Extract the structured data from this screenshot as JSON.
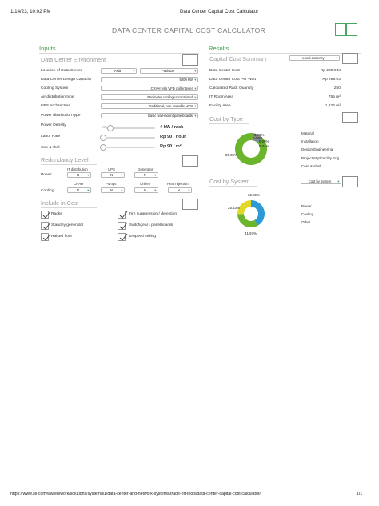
{
  "header": {
    "timestamp": "1/14/23, 10:02 PM",
    "page_title": "Data Center Capital Cost Calculator"
  },
  "footer": {
    "url": "https://www.se.com/ww/en/work/solutions/system/s1/data-center-and-network-systems/trade-off-tools/data-center-capital-cost-calculator/",
    "page_number": "1/1"
  },
  "app": {
    "title": "DATA CENTER CAPITAL COST CALCULATOR"
  },
  "inputs": {
    "heading": "Inputs",
    "environment": {
      "heading": "Data Center Environment",
      "rows": [
        {
          "label": "Location of Data Center",
          "region": "Asia",
          "country": "Pakistan"
        },
        {
          "label": "Data Center Design Capacity",
          "value": "5000 kW"
        },
        {
          "label": "Cooling System",
          "value": "CRAH with VFD chillertower"
        },
        {
          "label": "Air distribution type",
          "value": "Perimeter cooling uncontained"
        },
        {
          "label": "UPS Architecture",
          "value": "Traditional, non-scalable UPS"
        },
        {
          "label": "Power distribution type",
          "value": "Basic wall-mount panelboards"
        }
      ],
      "sliders": [
        {
          "label": "Power Density",
          "min_label": "kW",
          "value": "4 kW / rack",
          "level": 0.05
        },
        {
          "label": "Labor Rate",
          "value": "Rp 90 / hour",
          "level": 0.0
        },
        {
          "label": "Core & shell",
          "value": "Rp 90 / m²",
          "level": 0.0
        }
      ]
    },
    "redundancy": {
      "heading": "Redundancy Level",
      "power": {
        "label": "Power",
        "columns": [
          "IT distribution",
          "UPS",
          "Generator"
        ],
        "values": [
          "N",
          "N",
          "N"
        ]
      },
      "cooling": {
        "label": "Cooling",
        "columns": [
          "CRAH",
          "Pumps",
          "Chiller",
          "Heat rejection"
        ],
        "values": [
          "N",
          "N",
          "N",
          "N"
        ]
      }
    },
    "include": {
      "heading": "Include in Cost",
      "items": [
        {
          "label": "Racks",
          "checked": true
        },
        {
          "label": "Fire suppression / detection",
          "checked": true
        },
        {
          "label": "Standby generator",
          "checked": true
        },
        {
          "label": "Switchgear / panelboards",
          "checked": true
        },
        {
          "label": "Raised floor",
          "checked": true
        },
        {
          "label": "Dropped ceiling",
          "checked": true
        }
      ]
    }
  },
  "results": {
    "heading": "Results",
    "summary": {
      "heading": "Capital Cost Summary",
      "currency": "Local currency",
      "rows": [
        {
          "label": "Data Center Cost",
          "value": "Rp 289.0 M"
        },
        {
          "label": "Data Center Cost Per Watt",
          "value": "Rp 289.03"
        },
        {
          "label": "Calculated Rack Quantity",
          "value": "250"
        },
        {
          "label": "IT Room Area",
          "value": "755 m²"
        },
        {
          "label": "Facility Area",
          "value": "1,226 m²"
        }
      ]
    },
    "cost_by_type": {
      "heading": "Cost by Type",
      "legend": [
        "Material",
        "Installation",
        "Design/Engineering",
        "Project Mgt/Facility Eng.",
        "Core & shell"
      ],
      "labels": [
        "86.05%",
        "0.76%",
        "0.06%",
        "9.09%",
        "0.04%"
      ]
    },
    "cost_by_system": {
      "heading": "Cost by System",
      "dropdown": "Cost by system",
      "legend": [
        "Power",
        "Cooling",
        "Other"
      ],
      "labels": [
        "32.89%",
        "25.43%",
        "41.67%"
      ]
    }
  },
  "chart_data": [
    {
      "type": "pie",
      "categories": [
        "Material",
        "Installation",
        "Design/Engineering",
        "Project Mgt/Facility Eng.",
        "Core & shell"
      ],
      "values": [
        86.05,
        9.09,
        0.06,
        0.76,
        0.04
      ],
      "colors": [
        "#6bb52d",
        "#8a8a8a",
        "#3aa0d8",
        "#1d7db8",
        "#9b9b9b"
      ],
      "title": "Cost by Type",
      "legend": "right"
    },
    {
      "type": "pie",
      "categories": [
        "Power",
        "Cooling",
        "Other"
      ],
      "values": [
        41.67,
        32.89,
        25.43
      ],
      "colors": [
        "#2b9ad6",
        "#6bb52d",
        "#e3d829"
      ],
      "title": "Cost by System",
      "legend": "right"
    }
  ]
}
